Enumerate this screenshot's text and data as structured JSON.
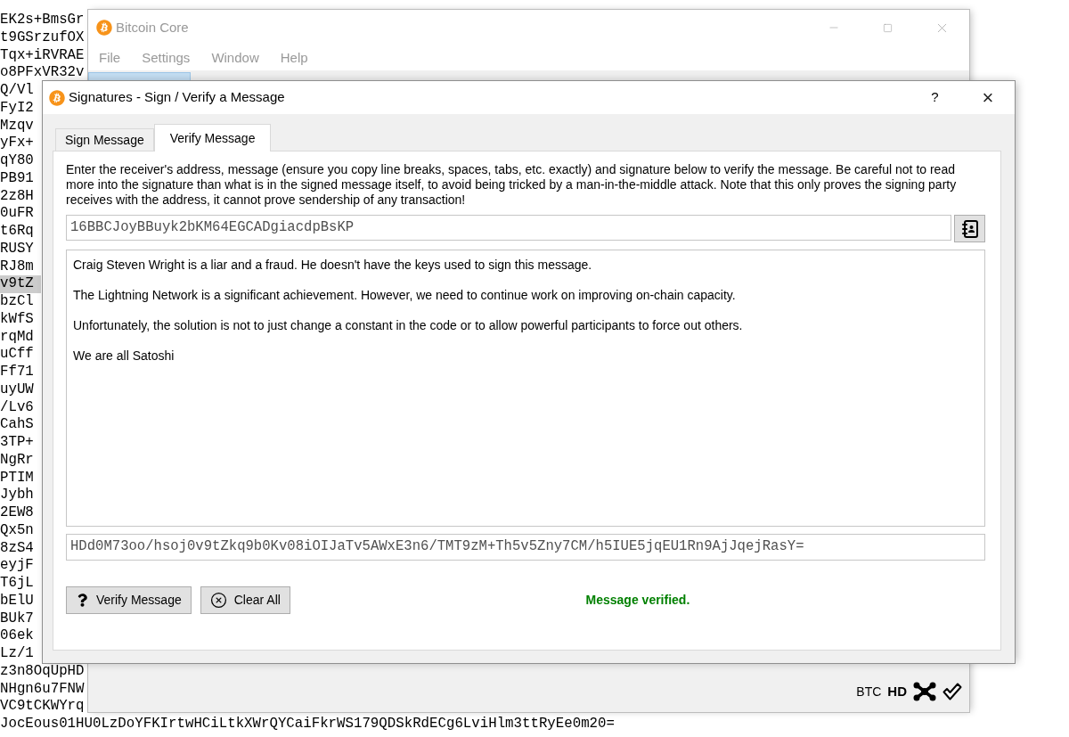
{
  "background_editor": {
    "lines": [
      {
        "text": "EK2s+BmsGr",
        "highlighted": false
      },
      {
        "text": "t9GSrzufOX",
        "highlighted": false
      },
      {
        "text": "Tqx+iRVRAE",
        "highlighted": false
      },
      {
        "text": "o8PFxVR32v",
        "highlighted": false
      },
      {
        "text": "Q/Vl",
        "highlighted": false
      },
      {
        "text": "FyI2",
        "highlighted": false
      },
      {
        "text": "Mzqv",
        "highlighted": false
      },
      {
        "text": "yFx+",
        "highlighted": false
      },
      {
        "text": "qY80",
        "highlighted": false
      },
      {
        "text": "PB91",
        "highlighted": false
      },
      {
        "text": "2z8H",
        "highlighted": false
      },
      {
        "text": "0uFR",
        "highlighted": false
      },
      {
        "text": "t6Rq",
        "highlighted": false
      },
      {
        "text": "RUSY",
        "highlighted": false
      },
      {
        "text": "RJ8m",
        "highlighted": false
      },
      {
        "text": "v9tZ",
        "highlighted": true
      },
      {
        "text": "bzCl",
        "highlighted": false
      },
      {
        "text": "kWfS",
        "highlighted": false
      },
      {
        "text": "rqMd",
        "highlighted": false
      },
      {
        "text": "uCff",
        "highlighted": false
      },
      {
        "text": "Ff71",
        "highlighted": false
      },
      {
        "text": "uyUW",
        "highlighted": false
      },
      {
        "text": "/Lv6",
        "highlighted": false
      },
      {
        "text": "CahS",
        "highlighted": false
      },
      {
        "text": "3TP+",
        "highlighted": false
      },
      {
        "text": "NgRr",
        "highlighted": false
      },
      {
        "text": "PTIM",
        "highlighted": false
      },
      {
        "text": "Jybh",
        "highlighted": false
      },
      {
        "text": "2EW8",
        "highlighted": false
      },
      {
        "text": "Qx5n",
        "highlighted": false
      },
      {
        "text": "8zS4",
        "highlighted": false
      },
      {
        "text": "eyjF",
        "highlighted": false
      },
      {
        "text": "T6jL",
        "highlighted": false
      },
      {
        "text": "bElU",
        "highlighted": false
      },
      {
        "text": "BUk7",
        "highlighted": false
      },
      {
        "text": "06ek",
        "highlighted": false
      },
      {
        "text": "Lz/1",
        "highlighted": false
      },
      {
        "text": "z3n8OqUpHD",
        "highlighted": false
      },
      {
        "text": "NHgn6u7FNW",
        "highlighted": false
      },
      {
        "text": "VC9tCKWYrq",
        "highlighted": false
      },
      {
        "text": "JocEous01HU0LzDoYFKIrtwHCiLtkXWrQYCaiFkrWS179QDSkRdECg6LviHlm3ttRyEe0m20=",
        "highlighted": false
      }
    ]
  },
  "main_window": {
    "title": "Bitcoin Core",
    "menu": [
      "File",
      "Settings",
      "Window",
      "Help"
    ],
    "toolbar": [
      {
        "selected": true
      }
    ],
    "status_bar": {
      "unit": "BTC",
      "wallet_type": "HD"
    }
  },
  "dialog": {
    "title": "Signatures - Sign / Verify a Message",
    "title_buttons": [
      {
        "kind": "help",
        "label": "?"
      },
      {
        "kind": "close",
        "label": "×"
      }
    ],
    "tabs": [
      {
        "label": "Sign Message",
        "selected": false
      },
      {
        "label": "Verify Message",
        "selected": true
      }
    ],
    "description": "Enter the receiver's address, message (ensure you copy line breaks, spaces, tabs, etc. exactly) and signature below to verify the message. Be careful not to read more into the signature than what is in the signed message itself, to avoid being tricked by a man-in-the-middle attack. Note that this only proves the signing party receives with the address, it cannot prove sendership of any transaction!",
    "address": "16BBCJoyBBuyk2bKM64EGCADgiacdpBsKP",
    "message": [
      "Craig Steven Wright is a liar and a fraud. He doesn't have the keys used to sign this message.",
      "The Lightning Network is a significant achievement. However, we need to continue work on improving on-chain capacity.",
      "Unfortunately, the solution is not to just change a constant in the code or to allow powerful participants to force out others.",
      "We are all Satoshi"
    ],
    "signature": "HDd0M73oo/hsoj0v9tZkq9b0Kv08iOIJaTv5AWxE3n6/TMT9zM+Th5v5Zny7CM/h5IUE5jqEU1Rn9AjJqejRasY=",
    "buttons": [
      {
        "kind": "verify",
        "label": "Verify Message"
      },
      {
        "kind": "clear",
        "label": "Clear All"
      }
    ],
    "status": "Message verified."
  }
}
